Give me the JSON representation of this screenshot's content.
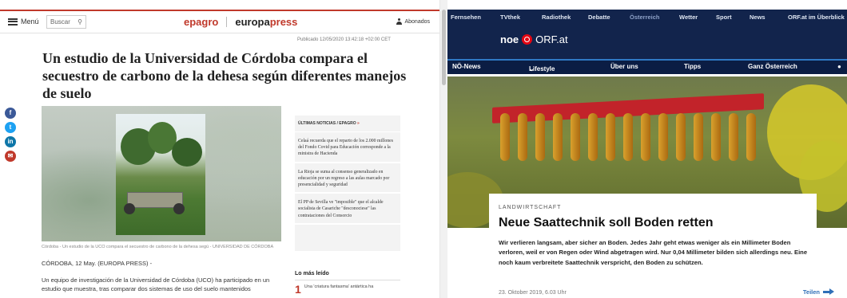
{
  "left": {
    "topbar": {
      "menu_label": "Menú",
      "search_placeholder": "Buscar",
      "logo_primary": "epagro",
      "logo_secondary_a": "europa",
      "logo_secondary_b": "press",
      "account_label": "Abonados"
    },
    "article": {
      "published": "Publicado 12/05/2020 13:42:18 +02:00 CET",
      "headline": "Un estudio de la Universidad de Córdoba compara el secuestro de carbono de la dehesa según diferentes manejos de suelo",
      "caption": "Córdoba - Un estudio de la UCO compara el secuestro de carbono de la dehesa segú - UNIVERSIDAD DE CÓRDOBA",
      "dateline": "CÓRDOBA, 12 May. (EUROPA PRESS) -",
      "body": "Un equipo de investigación de la Universidad de Córdoba (UCO) ha participado en un estudio que muestra, tras comparar dos sistemas de uso del suelo mantenidos"
    },
    "share": [
      {
        "icon": "facebook-icon",
        "glyph": "f",
        "color": "#3b5998"
      },
      {
        "icon": "twitter-icon",
        "glyph": "t",
        "color": "#1da1f2"
      },
      {
        "icon": "linkedin-icon",
        "glyph": "in",
        "color": "#0e76a8"
      },
      {
        "icon": "email-icon",
        "glyph": "✉",
        "color": "#c0392b"
      }
    ],
    "sidebar": {
      "heading": "ÚLTIMAS NOTICIAS / EPAGRO",
      "heading_arrow": "»",
      "items": [
        "Celaá recuerda que el reparto de los 2.000 millones del Fondo Covid para Educación corresponde a la ministra de Hacienda",
        "La Rioja se suma al consenso generalizado en educación por un regreso a las aulas marcado por presencialidad y seguridad",
        "El PP de Sevilla ve \"imposible\" que el alcalde socialista de Casariche \"desconociese\" las contrataciones del Consorcio"
      ]
    },
    "mas_leido": {
      "title": "Lo más leído",
      "items": [
        {
          "num": "1",
          "text": "Una 'criatura fantasma' antártica ha"
        }
      ]
    }
  },
  "right": {
    "nav": [
      "Fernsehen",
      "TVthek",
      "Radiothek",
      "Debatte",
      "Österreich",
      "Wetter",
      "Sport",
      "News",
      "ORF.at im Überblick"
    ],
    "logo_region": "noe",
    "logo_site": "ORF.at",
    "subnav": [
      "NÖ-News",
      "Lifestyle",
      "Über uns",
      "Tipps",
      "Ganz Österreich"
    ],
    "subnav_lifestyle_prefix": "⌄",
    "article": {
      "kicker": "LANDWIRTSCHAFT",
      "title": "Neue Saattechnik soll Boden retten",
      "body": "Wir verlieren langsam, aber sicher an Boden. Jedes Jahr geht etwas weniger als ein Millimeter Boden verloren, weil er von Regen oder Wind abgetragen wird. Nur 0,04 Millimeter bilden sich allerdings neu. Eine noch kaum verbreitete Saattechnik verspricht, den Boden zu schützen.",
      "date": "23. Oktober 2019, 6.03 Uhr",
      "share_label": "Teilen"
    }
  }
}
